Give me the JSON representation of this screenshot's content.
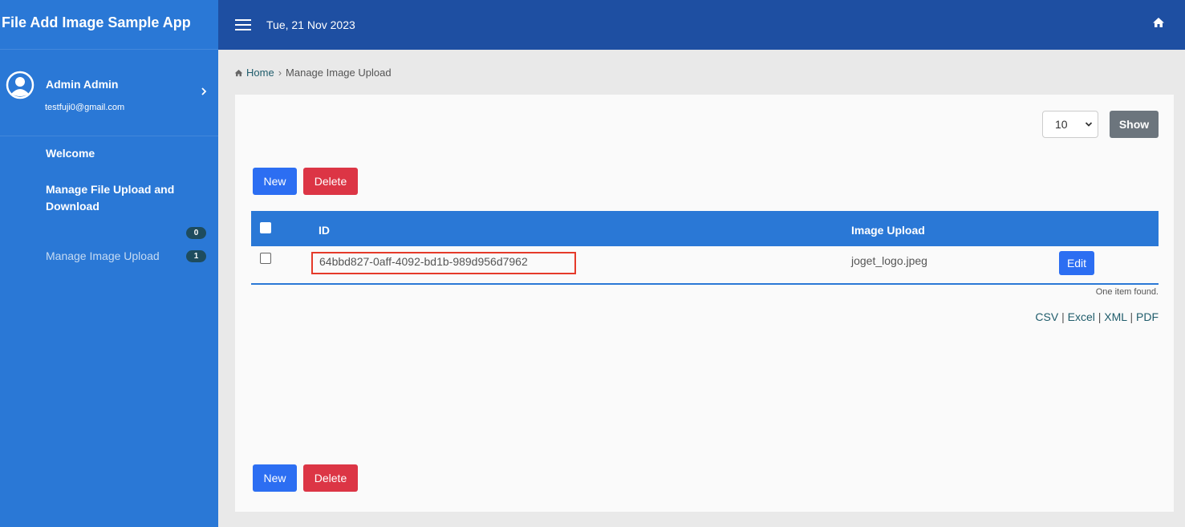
{
  "sidebar": {
    "app_title": "File Add Image Sample App",
    "user": {
      "name": "Admin Admin",
      "email": "testfuji0@gmail.com"
    },
    "items": [
      {
        "label": "Welcome"
      },
      {
        "label": "Manage File Upload and Download",
        "badge": "0"
      },
      {
        "label": "Manage Image Upload",
        "badge": "1"
      }
    ]
  },
  "header": {
    "date": "Tue, 21 Nov 2023"
  },
  "breadcrumb": {
    "home": "Home",
    "current": "Manage Image Upload"
  },
  "list": {
    "page_size": "10",
    "show_label": "Show",
    "new_label": "New",
    "delete_label": "Delete",
    "columns": {
      "id": "ID",
      "image": "Image Upload"
    },
    "rows": [
      {
        "id": "64bbd827-0aff-4092-bd1b-989d956d7962",
        "image": "joget_logo.jpeg",
        "edit_label": "Edit"
      }
    ],
    "found_text": "One item found.",
    "exports": {
      "csv": "CSV",
      "excel": "Excel",
      "xml": "XML",
      "pdf": "PDF",
      "separator": "|"
    }
  },
  "colors": {
    "sidebar": "#2a78d6",
    "header": "#1e4fa2",
    "primary": "#2c6ef2",
    "danger": "#dc3545",
    "highlight_box": "#e53a2a"
  }
}
